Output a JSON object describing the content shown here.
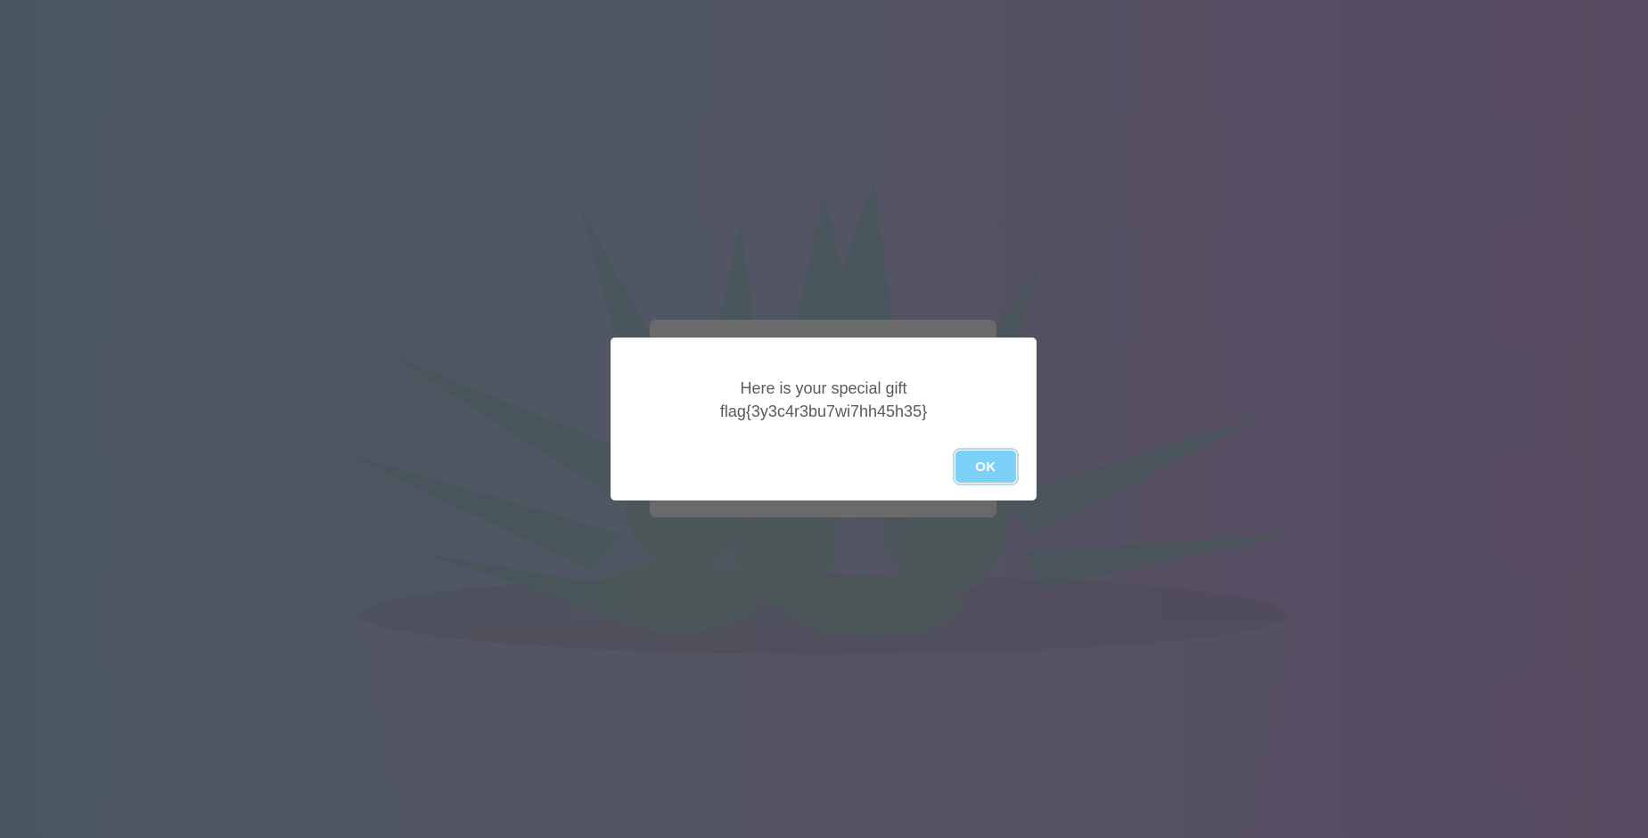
{
  "background": {
    "description_icon": "succulent-plant-photo",
    "gradient_left": "#4b5b64",
    "gradient_right": "#5b4b63"
  },
  "modal": {
    "line1": "Here is your special gift",
    "line2": "flag{3y3c4r3bu7wi7hh45h35}",
    "ok_label": "OK",
    "ok_color": "#7cd1f9"
  }
}
